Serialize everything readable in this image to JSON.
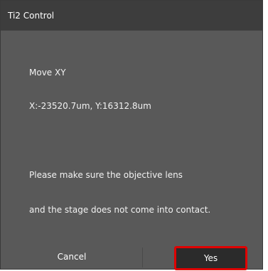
{
  "window": {
    "title": "Ti2 Control"
  },
  "message": {
    "heading": "Move XY",
    "coordinates": "X:-23520.7um, Y:16312.8um",
    "warning_line1": "Please make sure the objective lens",
    "warning_line2": "and the stage does not come into contact."
  },
  "buttons": {
    "cancel_label": "Cancel",
    "yes_label": "Yes"
  },
  "colors": {
    "dialog_bg": "#595959",
    "titlebar_bg": "#3d3d3d",
    "highlight": "#e00000"
  }
}
